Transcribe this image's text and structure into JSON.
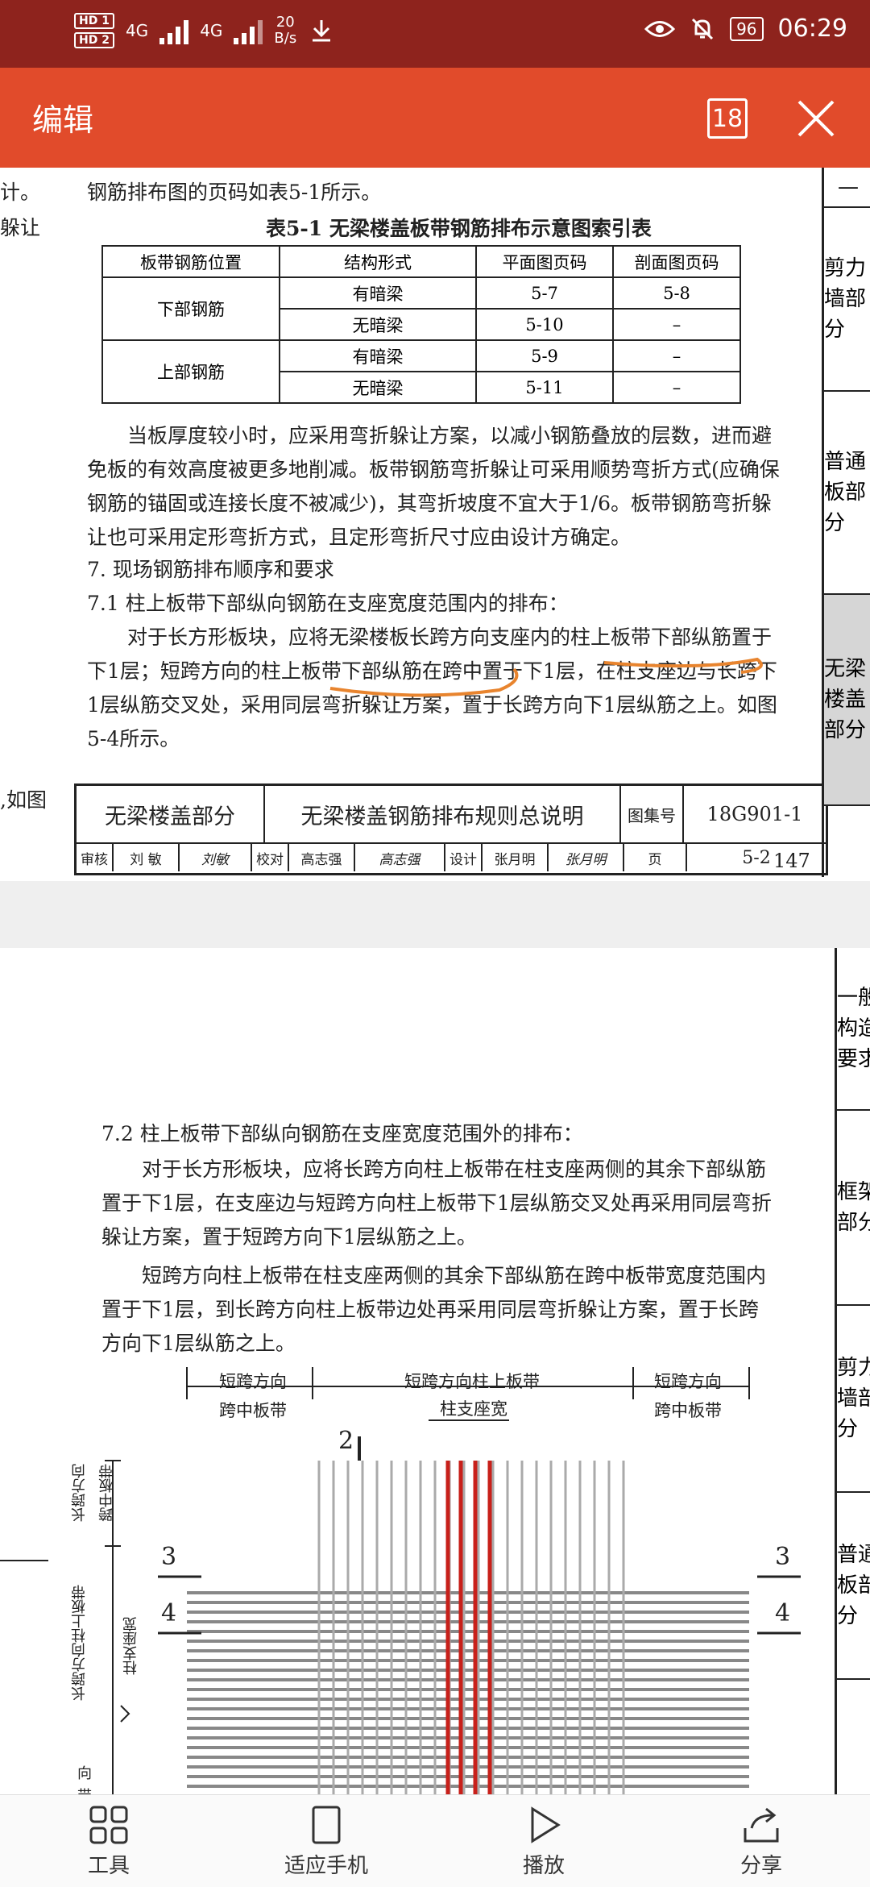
{
  "status": {
    "hd1": "HD 1",
    "hd2": "HD 2",
    "net1": "4G",
    "net2": "4G",
    "speed_value": "20",
    "speed_unit": "B/s",
    "battery": "96",
    "time": "06:29"
  },
  "appbar": {
    "title": "编辑",
    "page_count": "18"
  },
  "page1": {
    "left_fragment_1": "计。",
    "left_fragment_2": "躲让",
    "left_fragment_3": ",如图",
    "intro": "钢筋排布图的页码如表5-1所示。",
    "table_title": "表5-1  无梁楼盖板带钢筋排布示意图索引表",
    "table_headers": [
      "板带钢筋位置",
      "结构形式",
      "平面图页码",
      "剖面图页码"
    ],
    "table_rows": [
      {
        "pos": "下部钢筋",
        "form": "有暗梁",
        "plan": "5-7",
        "section": "5-8"
      },
      {
        "form": "无暗梁",
        "plan": "5-10",
        "section": "–"
      },
      {
        "pos": "上部钢筋",
        "form": "有暗梁",
        "plan": "5-9",
        "section": "–"
      },
      {
        "form": "无暗梁",
        "plan": "5-11",
        "section": "–"
      }
    ],
    "para1": "当板厚度较小时，应采用弯折躲让方案，以减小钢筋叠放的层数，进而避免板的有效高度被更多地削减。板带钢筋弯折躲让可采用顺势弯折方式(应确保钢筋的锚固或连接长度不被减少)，其弯折坡度不宜大于1/6。板带钢筋弯折躲让也可采用定形弯折方式，且定形弯折尺寸应由设计方确定。",
    "heading7": "7. 现场钢筋排布顺序和要求",
    "heading71": "7.1  柱上板带下部纵向钢筋在支座宽度范围内的排布：",
    "para2": "对于长方形板块，应将无梁楼板长跨方向支座内的柱上板带下部纵筋置于下1层；短跨方向的柱上板带下部纵筋在跨中置于下1层，在柱支座边与长跨下1层纵筋交叉处，采用同层弯折躲让方案，置于长跨方向下1层纵筋之上。如图5-4所示。",
    "titleblock": {
      "section": "无梁楼盖部分",
      "name": "无梁楼盖钢筋排布规则总说明",
      "atlas_label": "图集号",
      "atlas_no": "18G901-1",
      "review_label": "审核",
      "reviewer": "刘  敏",
      "review_sign": "刘敏",
      "check_label": "校对",
      "checker": "高志强",
      "check_sign": "高志强",
      "design_label": "设计",
      "designer": "张月明",
      "design_sign": "张月明",
      "page_label": "页",
      "page_no": "5-2"
    },
    "page_number": "147",
    "sidebar": [
      "剪力墙部分",
      "普通板部分",
      "无梁楼盖部分"
    ]
  },
  "page2": {
    "heading72": "7.2  柱上板带下部纵向钢筋在支座宽度范围外的排布：",
    "para1": "对于长方形板块，应将长跨方向柱上板带在柱支座两侧的其余下部纵筋置于下1层，在支座边与短跨方向柱上板带下1层纵筋交叉处再采用同层弯折躲让方案，置于短跨方向下1层纵筋之上。",
    "para2": "短跨方向柱上板带在柱支座两侧的其余下部纵筋在跨中板带宽度范围内置于下1层，到长跨方向柱上板带边处再采用同层弯折躲让方案，置于长跨方向下1层纵筋之上。",
    "diag": {
      "top_left_1": "短跨方向",
      "top_left_2": "跨中板带",
      "top_mid": "短跨方向柱上板带",
      "top_support": "柱支座宽",
      "top_right_1": "短跨方向",
      "top_right_2": "跨中板带",
      "side_1": "长跨方向",
      "side_2": "跨中板带",
      "side_3": "长跨方向柱上板带",
      "side_4": "柱支座宽",
      "side_5": "向",
      "side_6": "带",
      "mark2": "2",
      "mark3": "3",
      "mark4": "4"
    },
    "sidebar": [
      "一般构造要求",
      "框架部分",
      "剪力墙部分",
      "普通板部分"
    ]
  },
  "toolbar": {
    "tools": "工具",
    "fit": "适应手机",
    "play": "播放",
    "share": "分享"
  },
  "colors": {
    "statusbar": "#8e231d",
    "appbar": "#e14b2b",
    "annotation": "#e8842e",
    "rebar_red": "#c8201a"
  }
}
